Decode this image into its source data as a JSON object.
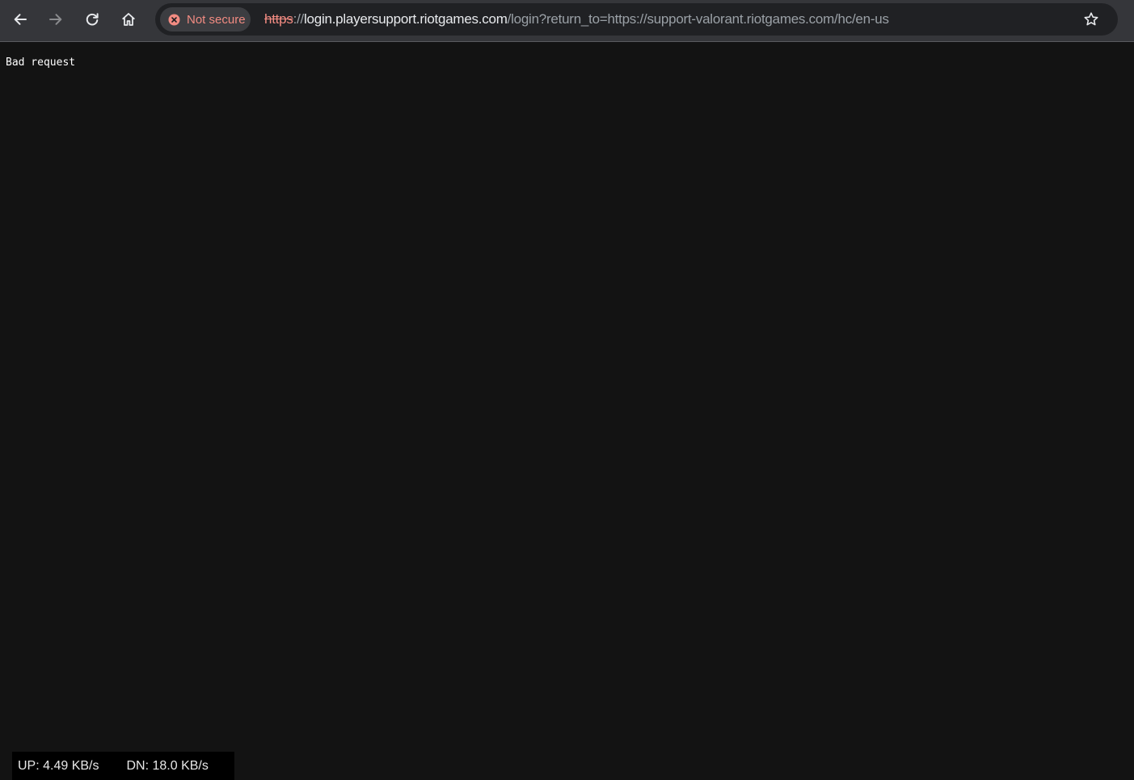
{
  "browser": {
    "security_label": "Not secure",
    "url": {
      "scheme": "https",
      "separator": "://",
      "host": "login.playersupport.riotgames.com",
      "path": "/login?return_to=https://support-valorant.riotgames.com/hc/en-us"
    },
    "icons": {
      "back": "back-arrow-icon",
      "forward": "forward-arrow-icon",
      "reload": "reload-icon",
      "home": "home-icon",
      "security": "error-circle-icon",
      "bookmark": "star-icon"
    },
    "colors": {
      "toolbar_bg": "#35363a",
      "omnibox_bg": "#202124",
      "warning": "#f28b82",
      "host_text": "#e8eaed",
      "muted_text": "#9aa0a6"
    }
  },
  "page": {
    "body_text": "Bad request",
    "background": "#131313"
  },
  "network_monitor": {
    "upload": "UP: 4.49 KB/s",
    "download": "DN: 18.0 KB/s"
  }
}
